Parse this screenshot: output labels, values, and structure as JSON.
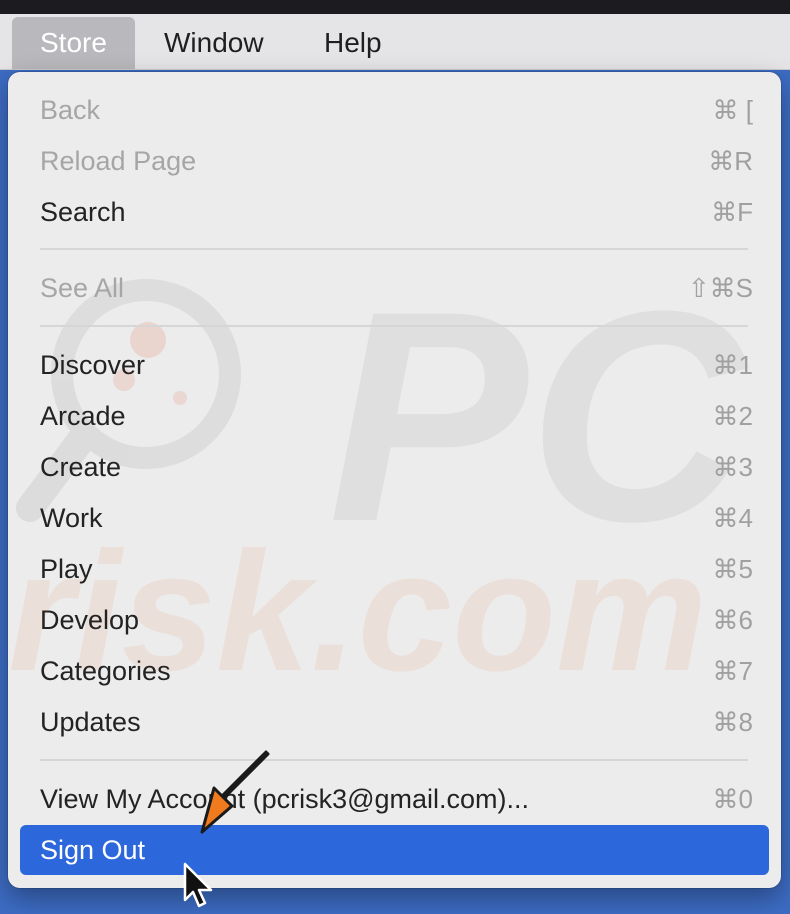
{
  "menubar": {
    "items": [
      {
        "label": "Store",
        "active": true
      },
      {
        "label": "Window",
        "active": false
      },
      {
        "label": "Help",
        "active": false
      }
    ]
  },
  "menu": {
    "items": [
      {
        "label": "Back",
        "shortcut": "⌘ [",
        "enabled": false
      },
      {
        "label": "Reload Page",
        "shortcut": "⌘R",
        "enabled": false
      },
      {
        "label": "Search",
        "shortcut": "⌘F",
        "enabled": true
      },
      {
        "label": "See All",
        "shortcut": "⇧⌘S",
        "enabled": false
      },
      {
        "label": "Discover",
        "shortcut": "⌘1",
        "enabled": true
      },
      {
        "label": "Arcade",
        "shortcut": "⌘2",
        "enabled": true
      },
      {
        "label": "Create",
        "shortcut": "⌘3",
        "enabled": true
      },
      {
        "label": "Work",
        "shortcut": "⌘4",
        "enabled": true
      },
      {
        "label": "Play",
        "shortcut": "⌘5",
        "enabled": true
      },
      {
        "label": "Develop",
        "shortcut": "⌘6",
        "enabled": true
      },
      {
        "label": "Categories",
        "shortcut": "⌘7",
        "enabled": true
      },
      {
        "label": "Updates",
        "shortcut": "⌘8",
        "enabled": true
      },
      {
        "label": "View My Account (pcrisk3@gmail.com)...",
        "shortcut": "⌘0",
        "enabled": true
      },
      {
        "label": "Sign Out",
        "shortcut": "",
        "enabled": true,
        "selected": true
      }
    ]
  },
  "watermark": {
    "text_top": "PC",
    "text_bottom": "risk.com"
  },
  "colors": {
    "selection": "#2c67dc",
    "desktop": "#3d6cc4",
    "menu_bg": "#ececec",
    "annotation_arrow": "#f07a1e"
  },
  "icons": {
    "arrow": "orange-arrow-icon",
    "cursor": "mouse-pointer-icon",
    "watermark": "magnifier-logo-icon"
  }
}
